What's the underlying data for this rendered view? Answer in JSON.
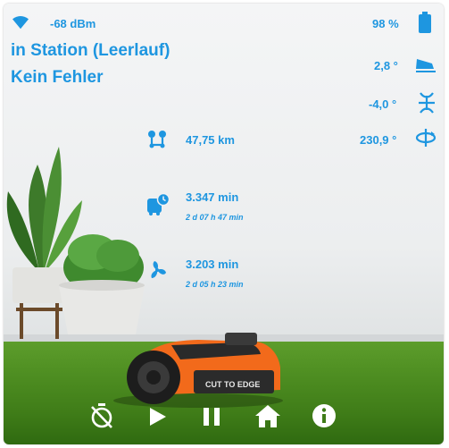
{
  "status": {
    "wifi_signal": "-68 dBm",
    "battery": "98 %",
    "state": "in Station (Leerlauf)",
    "error": "Kein Fehler",
    "pitch": "2,8 °",
    "roll": "-4,0 °",
    "yaw": "230,9 °",
    "distance": "47,75 km",
    "worktime_total": "3.347 min",
    "worktime_detail": "2 d 07 h 47 min",
    "blade_time_total": "3.203 min",
    "blade_time_detail": "2 d 05 h 23 min"
  },
  "product_label": "CUT TO EDGE",
  "colors": {
    "accent": "#1e96e0",
    "mower_orange": "#f26a1b",
    "grass": "#4f8f22"
  },
  "icons": {
    "wifi": "wifi-icon",
    "battery": "battery-icon",
    "pitch": "pitch-icon",
    "roll": "roll-icon",
    "yaw": "yaw-icon",
    "distance": "route-icon",
    "worktime": "bus-clock-icon",
    "blade": "fan-icon",
    "controls": [
      "timer-off-icon",
      "play-icon",
      "pause-icon",
      "home-icon",
      "info-icon"
    ]
  }
}
